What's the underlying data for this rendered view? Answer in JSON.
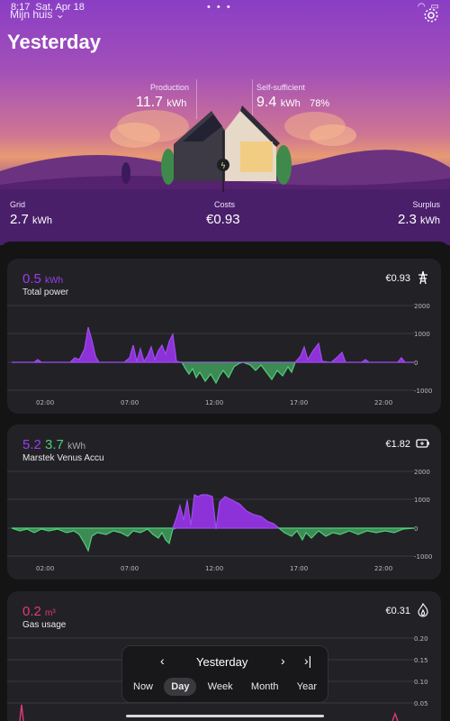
{
  "status": {
    "time": "8:17",
    "date": "Sat, Apr 18",
    "dots": "• • •"
  },
  "header": {
    "home": "Mijn huis",
    "title": "Yesterday"
  },
  "summary": {
    "production": {
      "label": "Production",
      "value": "11.7",
      "unit": "kWh"
    },
    "self_sufficient": {
      "label": "Self-sufficient",
      "value": "9.4",
      "unit": "kWh",
      "pct": "78%"
    },
    "grid": {
      "label": "Grid",
      "value": "2.7",
      "unit": "kWh"
    },
    "costs": {
      "label": "Costs",
      "value": "€0.93"
    },
    "surplus": {
      "label": "Surplus",
      "value": "2.3",
      "unit": "kWh"
    }
  },
  "cards": [
    {
      "value1": "0.5",
      "unit": "kWh",
      "subtitle": "Total power",
      "cost": "€0.93",
      "icon": "grid-tower-icon",
      "y_ticks": [
        "2000",
        "1000",
        "0",
        "-1000"
      ],
      "x_ticks": [
        "02:00",
        "07:00",
        "12:00",
        "17:00",
        "22:00"
      ]
    },
    {
      "value1": "5.2",
      "value2": "3.7",
      "unit": "kWh",
      "subtitle": "Marstek Venus  Accu",
      "cost": "€1.82",
      "icon": "battery-icon",
      "y_ticks": [
        "2000",
        "1000",
        "0",
        "-1000"
      ],
      "x_ticks": [
        "02:00",
        "07:00",
        "12:00",
        "17:00",
        "22:00"
      ]
    },
    {
      "value1": "0.2",
      "unit": "m³",
      "subtitle": "Gas usage",
      "cost": "€0.31",
      "icon": "flame-icon",
      "y_ticks": [
        "0.20",
        "0.15",
        "0.10",
        "0.05"
      ]
    }
  ],
  "nav": {
    "title": "Yesterday",
    "prev": "‹",
    "next": "›",
    "last": "›|",
    "tabs": [
      "Now",
      "Day",
      "Week",
      "Month",
      "Year"
    ],
    "active_tab": "Day"
  },
  "colors": {
    "purple": "#9b3cf0",
    "green": "#4fd07a",
    "gas": "#e03a78"
  }
}
